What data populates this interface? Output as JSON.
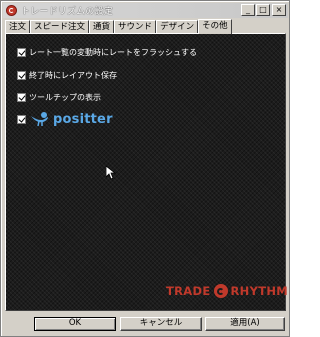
{
  "window": {
    "title": "トレードリズムの設定",
    "title_buttons": [
      "_",
      "□",
      "×"
    ]
  },
  "tabs": [
    "注文",
    "スピード注文",
    "通貨",
    "サウンド",
    "デザイン",
    "その他"
  ],
  "active_tab": "その他",
  "options": [
    {
      "label": "レート一覧の変動時にレートをフラッシュする",
      "checked": true
    },
    {
      "label": "終了時にレイアウト保存",
      "checked": true
    },
    {
      "label": "ツールチップの表示",
      "checked": true
    },
    {
      "label": "positter",
      "checked": true,
      "icon": "positter-bird-icon"
    }
  ],
  "brand": {
    "left": "TRADE",
    "right": "RHYTHM",
    "color": "#c0392b"
  },
  "buttons": {
    "ok": "OK",
    "cancel": "キャンセル",
    "apply": "適用(A)"
  }
}
